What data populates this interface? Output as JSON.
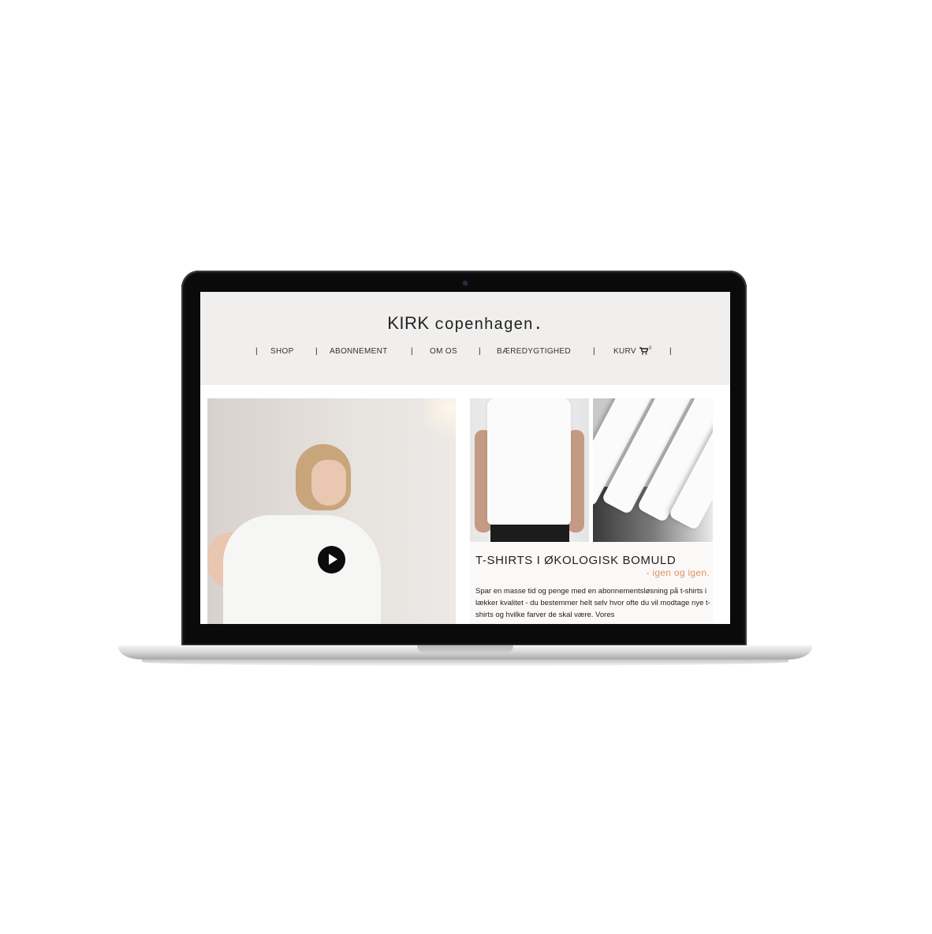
{
  "site": {
    "logo_brand": "KIRK",
    "logo_city": "copenhagen.",
    "nav": {
      "separator": "|",
      "shop": "SHOP",
      "abonnement": "ABONNEMENT",
      "om_os": "OM OS",
      "baeredygtighed": "BÆREDYGTIGHED",
      "kurv": "KURV",
      "cart_count": "0"
    }
  },
  "main": {
    "headline": "T-SHIRTS I ØKOLOGISK BOMULD",
    "subline": "- igen og igen.",
    "body_text": "Spar en masse tid og penge med en abonnementsløsning på t-shirts i lækker kvalitet - du bestemmer helt selv hvor ofte du vil modtage nye t-shirts og hvilke farver de skal være. Vores"
  },
  "colors": {
    "header_bg": "#f0efee",
    "accent": "#e0915e",
    "text": "#222222"
  },
  "icons": {
    "cart": "shopping-cart-icon",
    "play": "play-icon",
    "camera": "webcam-icon"
  }
}
